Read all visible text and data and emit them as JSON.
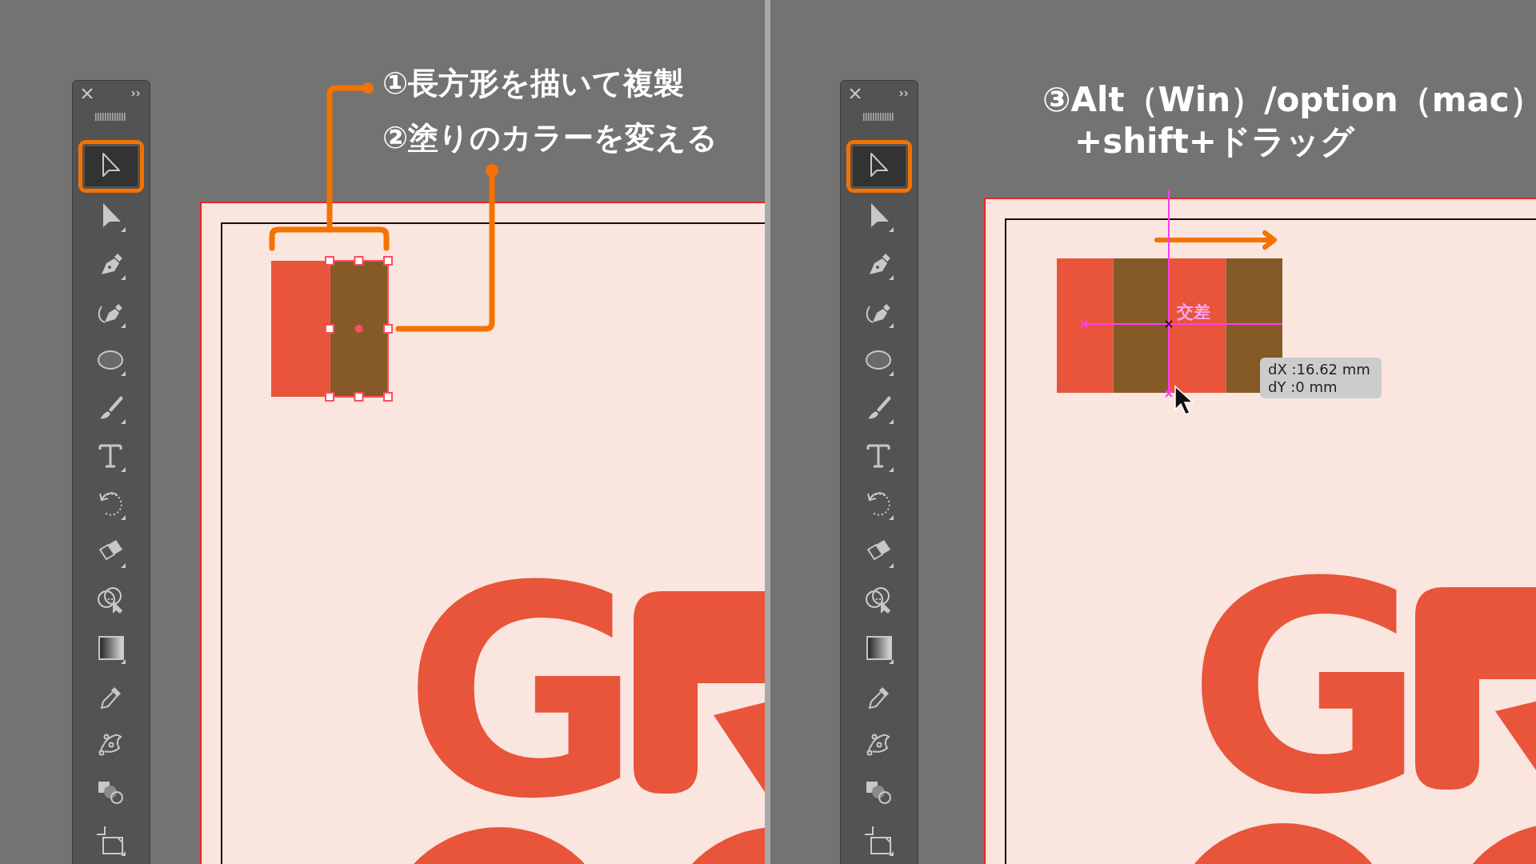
{
  "panels": [
    {
      "toolbar": {
        "tools": [
          {
            "kind": "selection",
            "selected": true
          },
          {
            "kind": "direct-selection",
            "selected": false
          },
          {
            "kind": "pen",
            "selected": false
          },
          {
            "kind": "curvature",
            "selected": false
          },
          {
            "kind": "ellipse",
            "selected": false
          },
          {
            "kind": "paintbrush",
            "selected": false
          },
          {
            "kind": "type",
            "selected": false
          },
          {
            "kind": "rotate",
            "selected": false
          },
          {
            "kind": "eraser",
            "selected": false
          },
          {
            "kind": "shape-builder",
            "selected": false
          },
          {
            "kind": "gradient",
            "selected": false
          },
          {
            "kind": "eyedropper",
            "selected": false
          },
          {
            "kind": "puppet-warp",
            "selected": false
          },
          {
            "kind": "blend",
            "selected": false
          },
          {
            "kind": "artboard",
            "selected": false
          }
        ]
      },
      "annotations": [
        {
          "text": "①長方形を描いて複製"
        },
        {
          "text": "②塗りのカラーを変える"
        }
      ],
      "shapes": [
        {
          "color": "#e8553a",
          "selected": false
        },
        {
          "color": "#855a27",
          "selected": true
        }
      ],
      "artboard_text": "G"
    },
    {
      "toolbar": {
        "tools": [
          {
            "kind": "selection",
            "selected": true
          },
          {
            "kind": "direct-selection",
            "selected": false
          },
          {
            "kind": "pen",
            "selected": false
          },
          {
            "kind": "curvature",
            "selected": false
          },
          {
            "kind": "ellipse",
            "selected": false
          },
          {
            "kind": "paintbrush",
            "selected": false
          },
          {
            "kind": "type",
            "selected": false
          },
          {
            "kind": "rotate",
            "selected": false
          },
          {
            "kind": "eraser",
            "selected": false
          },
          {
            "kind": "shape-builder",
            "selected": false
          },
          {
            "kind": "gradient",
            "selected": false
          },
          {
            "kind": "eyedropper",
            "selected": false
          },
          {
            "kind": "puppet-warp",
            "selected": false
          },
          {
            "kind": "blend",
            "selected": false
          },
          {
            "kind": "artboard",
            "selected": false
          }
        ]
      },
      "annotations": [
        {
          "text": "③Alt（Win）/option（mac）"
        },
        {
          "text": "+shift+ドラッグ"
        }
      ],
      "shapes": [
        {
          "color": "#e8553a",
          "selected": false
        },
        {
          "color": "#855a27",
          "selected": false
        },
        {
          "color": "#e8553a",
          "selected": false
        },
        {
          "color": "#855a27",
          "selected": false
        }
      ],
      "smart_guide_label": "交差",
      "drag_tooltip": [
        "dX :16.62 mm",
        "dY :0 mm"
      ],
      "artboard_text": "G"
    }
  ]
}
